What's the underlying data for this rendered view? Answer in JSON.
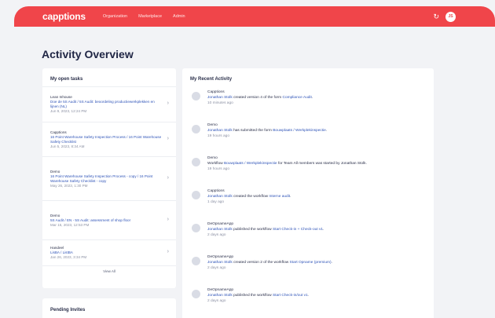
{
  "header": {
    "logo": "capptions",
    "nav": [
      "Organization",
      "Marketplace",
      "Admin"
    ],
    "avatar": "JS",
    "refresh_icon": "refresh-icon"
  },
  "page_title": "Activity Overview",
  "tasks": {
    "title": "My open tasks",
    "items": [
      {
        "org": "Lean Inhouse",
        "path": "Doe de 5S Audit / 5S Audit: beoordeling productiewerkplekken en lijnen (NL)",
        "date": "Jun 9, 2023, 12:24 PM"
      },
      {
        "org": "Capptions",
        "path": "16 Point Warehouse Safety Inspection Process / 16 Point Warehouse Safety Checklist",
        "date": "Jun 5, 2023, 8:34 AM"
      },
      {
        "org": "Demo",
        "path": "16 Point Warehouse Safety Inspection Process - copy / 16 Point Warehouse Safety Checklist - copy",
        "date": "May 26, 2023, 1:30 PM"
      },
      {
        "org": "Demo",
        "path": "5S Audit / EN - 5S Audit: assessment of shop floor",
        "date": "Mar 15, 2023, 12:53 PM"
      },
      {
        "org": "Handeel",
        "path": "LisBA / ListBA",
        "date": "Jan 26, 2023, 3:34 PM"
      }
    ],
    "view_all": "View All"
  },
  "pending": {
    "title": "Pending Invites"
  },
  "activity": {
    "title": "My Recent Activity",
    "items": [
      {
        "org": "Capptions",
        "actor": "Jonathan Stolk",
        "text1": " created version 4 of the form ",
        "target": "Compliance Audit",
        "text2": ".",
        "time": "10 minutes ago"
      },
      {
        "org": "Demo",
        "actor": "Jonathan Stolk",
        "text1": " has submitted the form ",
        "target": "Bouwplaats / Werkplekinspectie",
        "text2": ".",
        "time": "19 hours ago"
      },
      {
        "org": "Demo",
        "actor": "",
        "text1": "Workflow ",
        "target": "Bouwplaats / Werkplekinspectie",
        "text2": " for Team All members was started by Jonathan Stolk.",
        "time": "19 hours ago"
      },
      {
        "org": "Capptions",
        "actor": "Jonathan Stolk",
        "text1": " created the workflow ",
        "target": "Interne audit",
        "text2": ".",
        "time": "1 day ago"
      },
      {
        "org": "DeOpnameApp",
        "actor": "Jonathan Stolk",
        "text1": " published the workflow ",
        "target": "Start Check-in + Check-out v1",
        "text2": ".",
        "time": "2 days ago"
      },
      {
        "org": "DeOpnameApp",
        "actor": "Jonathan Stolk",
        "text1": " created version 2 of the workflow ",
        "target": "Start Opname (premium)",
        "text2": ".",
        "time": "2 days ago"
      },
      {
        "org": "DeOpnameApp",
        "actor": "Jonathan Stolk",
        "text1": " published the workflow ",
        "target": "Start Check-in/out v1",
        "text2": ".",
        "time": "2 days ago"
      }
    ]
  }
}
